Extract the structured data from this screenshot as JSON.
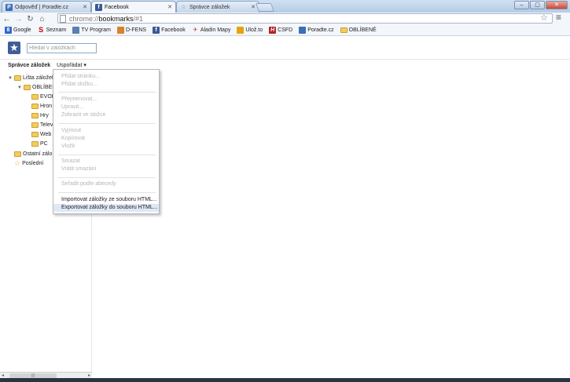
{
  "tabs": [
    {
      "title": "Odpověď | Poradte.cz",
      "icon": "poradte-icon",
      "color": "#3b6fb6"
    },
    {
      "title": "Facebook",
      "icon": "facebook-icon",
      "color": "#3b5998"
    },
    {
      "title": "Správce záložek",
      "icon": "bookmark-star-icon",
      "color": "#999999"
    }
  ],
  "window": {
    "min": "–",
    "max": "▢",
    "close": "✕"
  },
  "omnibox": {
    "scheme": "chrome://",
    "host": "bookmarks",
    "path": "/#1"
  },
  "bookmarks_bar": [
    {
      "label": "Google",
      "icon": "google-icon",
      "color": "#3366cc"
    },
    {
      "label": "Seznam",
      "icon": "seznam-icon",
      "color": "#cc0000"
    },
    {
      "label": "TV Program",
      "icon": "tv-icon",
      "color": "#5a7fb0"
    },
    {
      "label": "D-FENS",
      "icon": "dfens-icon",
      "color": "#d9822b"
    },
    {
      "label": "Facebook",
      "icon": "facebook-icon",
      "color": "#3b5998"
    },
    {
      "label": "Aladin Mapy",
      "icon": "map-icon",
      "color": "#c0392b"
    },
    {
      "label": "Ulož.to",
      "icon": "ulozto-icon",
      "color": "#e5a50a"
    },
    {
      "label": "CSFD",
      "icon": "csfd-icon",
      "color": "#b22222"
    },
    {
      "label": "Poradte.cz",
      "icon": "poradte-icon",
      "color": "#3b6fb6"
    },
    {
      "label": "OBLÍBENÉ",
      "icon": "folder-icon",
      "color": "#f2cc5d"
    }
  ],
  "header": {
    "search_placeholder": "Hledat v záložkách"
  },
  "manager": {
    "title": "Správce záložek",
    "organize": "Uspořádat ▾"
  },
  "tree": [
    {
      "label": "Lišta záložek",
      "level": 0,
      "expanded": true
    },
    {
      "label": "OBLÍBENÉ",
      "level": 1,
      "expanded": true
    },
    {
      "label": "EVOL",
      "level": 2
    },
    {
      "label": "Hron",
      "level": 2
    },
    {
      "label": "Hry",
      "level": 2
    },
    {
      "label": "Telev",
      "level": 2
    },
    {
      "label": "Web",
      "level": 2
    },
    {
      "label": "PC",
      "level": 2
    },
    {
      "label": "Ostatní zálo",
      "level": 0
    },
    {
      "label": "Poslední",
      "level": 0,
      "icon": "star"
    }
  ],
  "menu": {
    "groups": [
      [
        {
          "label": "Přidat stránku...",
          "enabled": false
        },
        {
          "label": "Přidat složku...",
          "enabled": false
        }
      ],
      [
        {
          "label": "Přejmenovat...",
          "enabled": false
        },
        {
          "label": "Upravit...",
          "enabled": false
        },
        {
          "label": "Zobrazit ve složce",
          "enabled": false
        }
      ],
      [
        {
          "label": "Vyjmout",
          "enabled": false
        },
        {
          "label": "Kopírovat",
          "enabled": false
        },
        {
          "label": "Vložit",
          "enabled": false
        }
      ],
      [
        {
          "label": "Smazat",
          "enabled": false
        },
        {
          "label": "Vrátit smazání",
          "enabled": false
        }
      ],
      [
        {
          "label": "Seřadit podle abecedy",
          "enabled": false
        }
      ],
      [
        {
          "label": "Importovat záložky ze souboru HTML...",
          "enabled": true
        },
        {
          "label": "Exportovat záložky do souboru HTML...",
          "enabled": true,
          "highlighted": true
        }
      ]
    ]
  }
}
